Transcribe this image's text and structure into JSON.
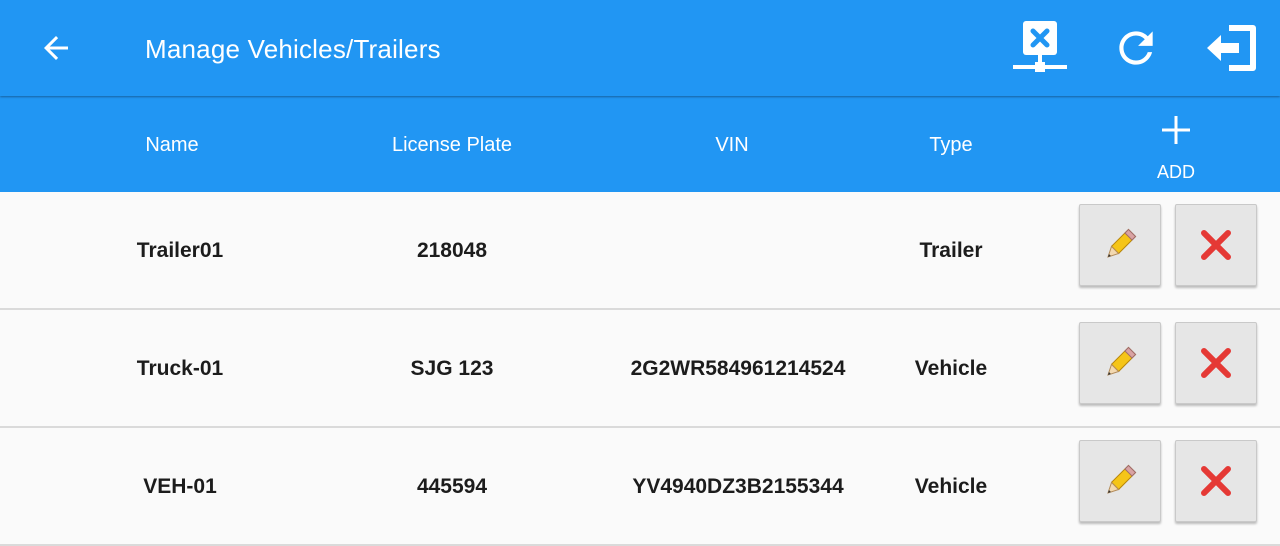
{
  "appbar": {
    "title": "Manage Vehicles/Trailers",
    "icons": {
      "back": "arrow-back-icon",
      "network": "network-disconnected-icon",
      "refresh": "refresh-icon",
      "logout": "logout-icon"
    }
  },
  "table": {
    "headers": {
      "name": "Name",
      "plate": "License Plate",
      "vin": "VIN",
      "type": "Type"
    },
    "add_label": "ADD",
    "rows": [
      {
        "name": "Trailer01",
        "plate": "218048",
        "vin": "",
        "type": "Trailer"
      },
      {
        "name": "Truck-01",
        "plate": "SJG 123",
        "vin": "2G2WR584961214524",
        "type": "Vehicle"
      },
      {
        "name": "VEH-01",
        "plate": "445594",
        "vin": "YV4940DZ3B2155344",
        "type": "Vehicle"
      }
    ]
  },
  "colors": {
    "primary": "#2196f3",
    "delete_red": "#e53935",
    "pencil_yellow": "#f5c518"
  }
}
